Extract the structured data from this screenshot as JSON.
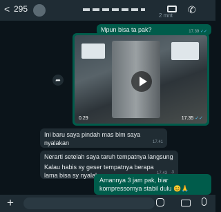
{
  "header": {
    "back_glyph": "<",
    "unread_count": "295",
    "peek_time": "16.46",
    "peek_label": "2 mnt"
  },
  "messages": [
    {
      "dir": "out",
      "text": "Mpun bisa ta pak?",
      "time": "17.39",
      "ticks": "✓✓"
    },
    {
      "dir": "out",
      "type": "video",
      "duration": "0.29",
      "time": "17.35",
      "ticks": "✓✓"
    },
    {
      "dir": "in",
      "text": "Ini baru saya pindah mas blm saya nyalakan",
      "time": "17.41"
    },
    {
      "dir": "in",
      "text": "Nerarti setelah saya taruh tempatnya langsung dicolokkan lanjut pengaturan suhunya gitu ngeh",
      "time": "17.43"
    },
    {
      "dir": "in",
      "text": "Kalau habis sy geser tempatnya berapa lama bisa sy nyalakan",
      "time": "17.43"
    },
    {
      "dir": "out",
      "text": "Amannya 3 jam pak, biar kompressornya stabil dulu 😊🙏"
    }
  ],
  "input_bar": {
    "plus_glyph": "+"
  },
  "colors": {
    "background": "#0b141a",
    "outgoing_bubble": "#005c4b",
    "incoming_bubble": "#202c33",
    "read_ticks": "#53bdeb"
  },
  "icons": [
    "back-arrow-icon",
    "video-call-icon",
    "voice-call-icon",
    "play-icon",
    "forward-icon",
    "scroll-down-icon",
    "plus-icon",
    "sticker-icon",
    "camera-icon",
    "microphone-icon"
  ]
}
